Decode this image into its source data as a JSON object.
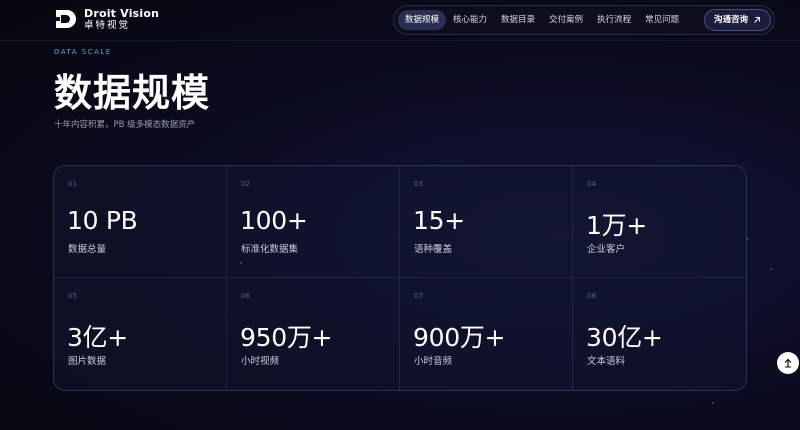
{
  "brand": {
    "name_en": "Droit Vision",
    "name_cn": "卓特视觉"
  },
  "nav": {
    "items": [
      "数据规模",
      "核心能力",
      "数据目录",
      "交付案例",
      "执行流程",
      "常见问题"
    ],
    "active_index": 0,
    "cta_label": "沟通咨询",
    "cta_icon": "arrow-up-right-icon"
  },
  "hero": {
    "eyebrow": "DATA SCALE",
    "title": "数据规模",
    "subtitle": "十年内容积累，PB 级多模态数据资产"
  },
  "stats": [
    {
      "num": "01",
      "value": "10 PB",
      "label": "数据总量"
    },
    {
      "num": "02",
      "value": "100+",
      "label": "标准化数据集"
    },
    {
      "num": "03",
      "value": "15+",
      "label": "语种覆盖"
    },
    {
      "num": "04",
      "value": "1万+",
      "label": "企业客户"
    },
    {
      "num": "05",
      "value": "3亿+",
      "label": "图片数据"
    },
    {
      "num": "06",
      "value": "950万+",
      "label": "小时视频"
    },
    {
      "num": "07",
      "value": "900万+",
      "label": "小时音频"
    },
    {
      "num": "08",
      "value": "30亿+",
      "label": "文本语料"
    }
  ],
  "scroll_top_icon": "arrow-up-icon",
  "colors": {
    "accent": "#5aa7c8",
    "background": "#06070f",
    "card_border": "#2b3356"
  }
}
